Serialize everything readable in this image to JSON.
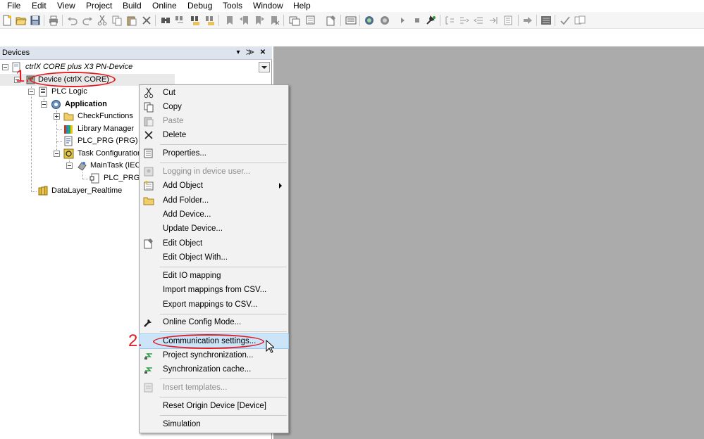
{
  "menubar": {
    "items": [
      "File",
      "Edit",
      "View",
      "Project",
      "Build",
      "Online",
      "Debug",
      "Tools",
      "Window",
      "Help"
    ]
  },
  "devices_panel": {
    "title": "Devices",
    "pin_glyph": "⨠",
    "close_glyph": "✕",
    "menu_glyph": "▾"
  },
  "tree": {
    "root": "ctrlX CORE plus X3 PN-Device",
    "device": "Device (ctrlX CORE)",
    "plc_logic": "PLC Logic",
    "application": "Application",
    "check_functions": "CheckFunctions",
    "library_manager": "Library Manager",
    "plc_prg_prg": "PLC_PRG (PRG)",
    "task_configuration": "Task Configuration",
    "main_task": "MainTask (IEC-T",
    "plc_prg": "PLC_PRG",
    "datalayer": "DataLayer_Realtime"
  },
  "context_menu": {
    "cut": "Cut",
    "copy": "Copy",
    "paste": "Paste",
    "delete": "Delete",
    "properties": "Properties...",
    "logging_in": "Logging in device user...",
    "add_object": "Add Object",
    "add_folder": "Add Folder...",
    "add_device": "Add Device...",
    "update_device": "Update Device...",
    "edit_object": "Edit Object",
    "edit_object_with": "Edit Object With...",
    "edit_io_mapping": "Edit IO mapping",
    "import_mappings": "Import mappings from CSV...",
    "export_mappings": "Export mappings to CSV...",
    "online_config_mode": "Online Config Mode...",
    "communication_settings": "Communication settings...",
    "project_synchronization": "Project synchronization...",
    "synchronization_cache": "Synchronization cache...",
    "insert_templates": "Insert templates...",
    "reset_origin_device": "Reset Origin Device [Device]",
    "simulation": "Simulation"
  },
  "annotations": {
    "step1": "1.",
    "step2": "2.",
    "color": "#e21b23"
  },
  "colors": {
    "panel_header": "#dde4ee",
    "editor_background": "#ababab",
    "menu_highlight": "#cce4f7"
  }
}
